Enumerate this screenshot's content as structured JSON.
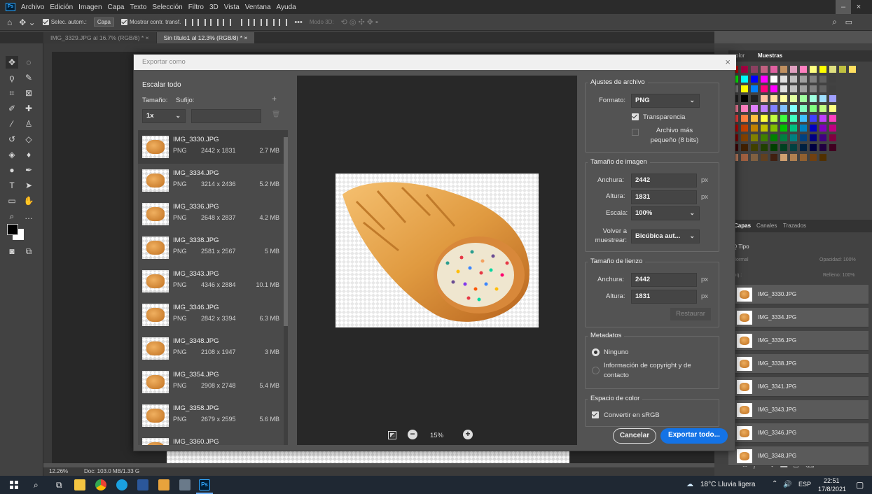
{
  "menubar": {
    "logo": "Ps",
    "items": [
      "Archivo",
      "Edición",
      "Imagen",
      "Capa",
      "Texto",
      "Selección",
      "Filtro",
      "3D",
      "Vista",
      "Ventana",
      "Ayuda"
    ]
  },
  "options": {
    "auto_select": "Selec. autom.:",
    "layer_select": "Capa",
    "show_transform": "Mostrar contr. transf.",
    "more": "•••",
    "mode3d": "Modo 3D:"
  },
  "tabs": [
    {
      "label": "IMG_3329.JPG al 16.7% (RGB/8) *",
      "close": "×"
    },
    {
      "label": "Sin título1 al 12.3% (RGB/8) *",
      "close": "×"
    }
  ],
  "dialog": {
    "title": "Exportar como",
    "close": "×",
    "scale_all": {
      "title": "Escalar todo",
      "size_label": "Tamaño:",
      "suffix_label": "Sufijo:",
      "size_value": "1x",
      "add": "+"
    },
    "files": [
      {
        "name": "IMG_3330.JPG",
        "type": "PNG",
        "dims": "2442 x 1831",
        "size": "2.7 MB"
      },
      {
        "name": "IMG_3334.JPG",
        "type": "PNG",
        "dims": "3214 x 2436",
        "size": "5.2 MB"
      },
      {
        "name": "IMG_3336.JPG",
        "type": "PNG",
        "dims": "2648 x 2837",
        "size": "4.2 MB"
      },
      {
        "name": "IMG_3338.JPG",
        "type": "PNG",
        "dims": "2581 x 2567",
        "size": "5 MB"
      },
      {
        "name": "IMG_3343.JPG",
        "type": "PNG",
        "dims": "4346 x 2884",
        "size": "10.1 MB"
      },
      {
        "name": "IMG_3346.JPG",
        "type": "PNG",
        "dims": "2842 x 3394",
        "size": "6.3 MB"
      },
      {
        "name": "IMG_3348.JPG",
        "type": "PNG",
        "dims": "2108 x 1947",
        "size": "3 MB"
      },
      {
        "name": "IMG_3354.JPG",
        "type": "PNG",
        "dims": "2908 x 2748",
        "size": "5.4 MB"
      },
      {
        "name": "IMG_3358.JPG",
        "type": "PNG",
        "dims": "2679 x 2595",
        "size": "5.6 MB"
      },
      {
        "name": "IMG_3360.JPG",
        "type": "",
        "dims": "",
        "size": ""
      }
    ],
    "zoom": "15%",
    "file_settings": {
      "title": "Ajustes de archivo",
      "format_label": "Formato:",
      "format_value": "PNG",
      "transparency": "Transparencia",
      "smaller_file": "Archivo más pequeño (8 bits)"
    },
    "image_size": {
      "title": "Tamaño de imagen",
      "width_label": "Anchura:",
      "width_value": "2442",
      "height_label": "Altura:",
      "height_value": "1831",
      "unit": "px",
      "scale_label": "Escala:",
      "scale_value": "100%",
      "resample_label": "Volver a muestrear:",
      "resample_value": "Bicúbica aut..."
    },
    "canvas_size": {
      "title": "Tamaño de lienzo",
      "width_label": "Anchura:",
      "width_value": "2442",
      "height_label": "Altura:",
      "height_value": "1831",
      "unit": "px",
      "reset": "Restaurar"
    },
    "metadata": {
      "title": "Metadatos",
      "none": "Ninguno",
      "copyright": "Información de copyright y de contacto"
    },
    "color_space": {
      "title": "Espacio de color",
      "srgb": "Convertir en sRGB"
    },
    "cancel": "Cancelar",
    "export": "Exportar todo..."
  },
  "right": {
    "swatch_tabs": [
      "olor",
      "Muestras"
    ],
    "layer_tabs": [
      "Capas",
      "Canales",
      "Trazados"
    ],
    "kind": "Q Tipo",
    "blend": "Normal",
    "opacity": "Opacidad: 100%",
    "lock": "loq.:",
    "fill": "Relleno: 100%",
    "layers": [
      "IMG_3330.JPG",
      "IMG_3334.JPG",
      "IMG_3336.JPG",
      "IMG_3338.JPG",
      "IMG_3341.JPG",
      "IMG_3343.JPG",
      "IMG_3346.JPG",
      "IMG_3348.JPG"
    ]
  },
  "status": {
    "zoom": "12.26%",
    "doc": "Doc: 103.0 MB/1.33 G"
  },
  "taskbar": {
    "weather": "18°C Lluvia ligera",
    "lang": "ESP",
    "time": "22:51",
    "date": "17/8/2021"
  }
}
